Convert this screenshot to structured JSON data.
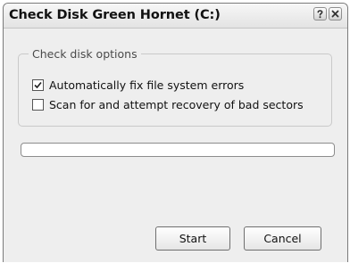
{
  "window": {
    "title": "Check Disk Green Hornet (C:)",
    "help_icon": "help-icon",
    "close_icon": "close-icon"
  },
  "options": {
    "group_label": "Check disk options",
    "items": [
      {
        "label": "Automatically fix file system errors",
        "checked": true
      },
      {
        "label": "Scan for and attempt recovery of bad sectors",
        "checked": false
      }
    ]
  },
  "progress": {
    "value": 0
  },
  "buttons": {
    "start_label": "Start",
    "cancel_label": "Cancel"
  }
}
